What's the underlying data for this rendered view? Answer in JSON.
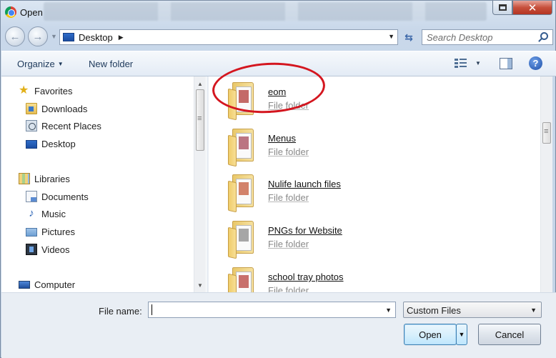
{
  "window": {
    "title": "Open",
    "close_label": "✕"
  },
  "address": {
    "location": "Desktop",
    "search_placeholder": "Search Desktop"
  },
  "toolbar": {
    "organize_label": "Organize",
    "new_folder_label": "New folder",
    "help_label": "?"
  },
  "nav": {
    "favorites": "Favorites",
    "downloads": "Downloads",
    "recent_places": "Recent Places",
    "desktop": "Desktop",
    "libraries": "Libraries",
    "documents": "Documents",
    "music": "Music",
    "pictures": "Pictures",
    "videos": "Videos",
    "computer": "Computer"
  },
  "files": [
    {
      "name": "eom",
      "type": "File folder",
      "accent": "#b23a36"
    },
    {
      "name": "Menus",
      "type": "File folder",
      "accent": "#a5485a"
    },
    {
      "name": "Nulife launch files",
      "type": "File folder",
      "accent": "#c45a3a"
    },
    {
      "name": "PNGs for Website",
      "type": "File folder",
      "accent": "#8a8a8a"
    },
    {
      "name": "school tray photos",
      "type": "File folder",
      "accent": "#b7413c"
    }
  ],
  "bottom": {
    "file_name_label": "File name:",
    "file_name_value": "",
    "filter_value": "Custom Files",
    "open_label": "Open",
    "cancel_label": "Cancel"
  },
  "colors": {
    "highlight_ring": "#d4161f",
    "accent": "#1e395b"
  }
}
